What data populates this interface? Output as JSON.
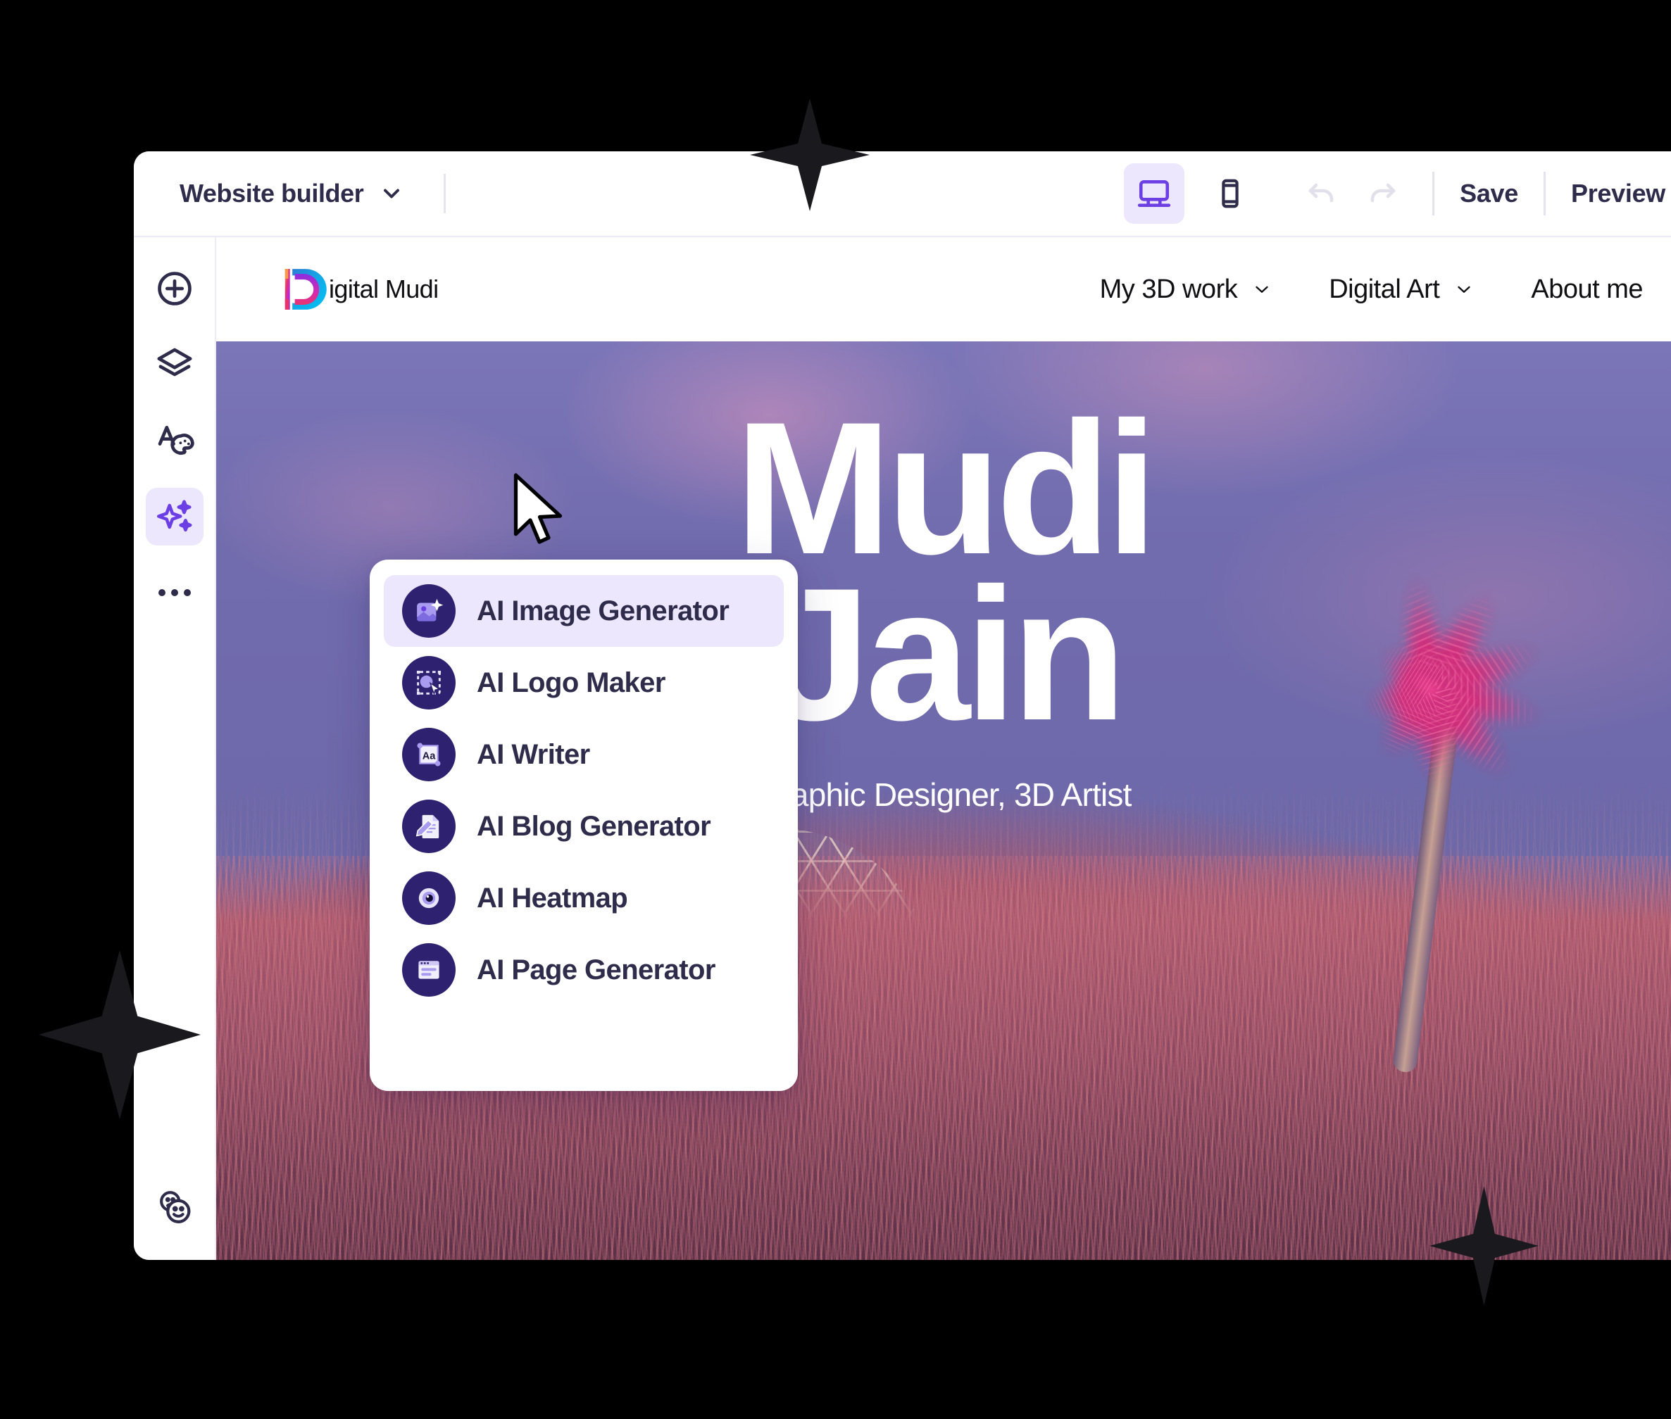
{
  "builder": {
    "title": "Website builder",
    "title_chevron_icon": "chevron-down-icon",
    "devices": [
      {
        "name": "desktop-view",
        "icon": "desktop-icon",
        "active": true
      },
      {
        "name": "mobile-view",
        "icon": "mobile-icon",
        "active": false
      }
    ],
    "history": [
      {
        "name": "undo",
        "icon": "undo-icon",
        "disabled": true
      },
      {
        "name": "redo",
        "icon": "redo-icon",
        "disabled": true
      }
    ],
    "save_label": "Save",
    "preview_label": "Preview"
  },
  "sidebar": {
    "items": [
      {
        "label": "Add",
        "icon": "plus-circle-icon",
        "active": false
      },
      {
        "label": "Layers",
        "icon": "layers-icon",
        "active": false
      },
      {
        "label": "Design",
        "icon": "text-palette-icon",
        "active": false
      },
      {
        "label": "AI Tools",
        "icon": "sparkles-icon",
        "active": true
      },
      {
        "label": "More",
        "icon": "more-dots-icon",
        "active": false
      }
    ],
    "bottom_item": {
      "label": "Feedback",
      "icon": "emoji-faces-icon"
    }
  },
  "ai_menu": {
    "items": [
      {
        "label": "AI Image Generator",
        "icon": "ai-image-icon",
        "active": true
      },
      {
        "label": "AI Logo Maker",
        "icon": "ai-logo-icon",
        "active": false
      },
      {
        "label": "AI Writer",
        "icon": "ai-writer-icon",
        "active": false
      },
      {
        "label": "AI Blog Generator",
        "icon": "ai-blog-icon",
        "active": false
      },
      {
        "label": "AI Heatmap",
        "icon": "ai-heatmap-icon",
        "active": false
      },
      {
        "label": "AI Page Generator",
        "icon": "ai-page-icon",
        "active": false
      }
    ]
  },
  "site": {
    "logo": {
      "mark": "D",
      "text": "igital Mudi"
    },
    "nav": [
      {
        "label": "My 3D work",
        "has_dropdown": true
      },
      {
        "label": "Digital Art",
        "has_dropdown": true
      },
      {
        "label": "About me",
        "has_dropdown": false
      }
    ],
    "hero": {
      "title_line1": "Mudi",
      "title_line2": "Jain",
      "subtitle": "Graphic Designer, 3D Artist"
    }
  },
  "cursor": {
    "icon": "mouse-pointer-icon"
  },
  "decor": {
    "sparkles": [
      "sparkle-top",
      "sparkle-left",
      "sparkle-bottom-right"
    ]
  },
  "colors": {
    "accent": "#6b3fe4",
    "accent_soft": "#ece7fd",
    "ink": "#2e2c4a",
    "icon_circle": "#2e2170",
    "page_background": "#000000"
  }
}
